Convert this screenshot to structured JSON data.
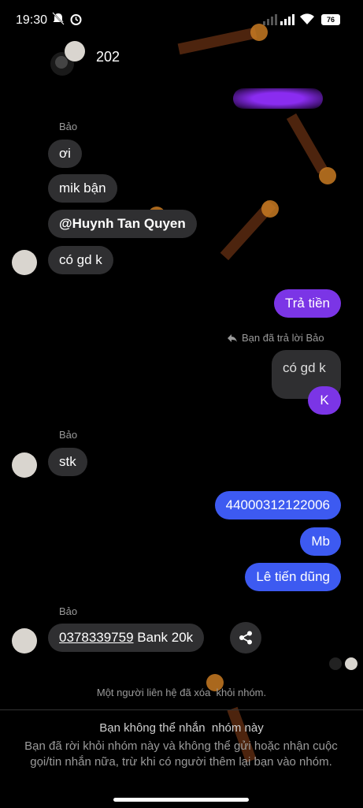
{
  "status": {
    "time": "19:30",
    "battery": "76"
  },
  "header": {
    "title": "202"
  },
  "messages": {
    "sender1": "Bảo",
    "m1": "ơi",
    "m2": "mik bận",
    "m3": "@Huynh Tan Quyen",
    "m4": "có gd k",
    "out1": "Trả tiền",
    "reply_note": "Bạn đã trả lời Bảo",
    "quoted": "có gd k",
    "reply": "K",
    "sender2": "Bảo",
    "m5": "stk",
    "out2": "44000312122006",
    "out3": "Mb",
    "out4": "Lê tiến dũng",
    "sender3": "Bảo",
    "m6_link": "0378339759",
    "m6_rest": " Bank 20k",
    "system_note": "Một người liên hệ đã xóa  khỏi nhóm."
  },
  "footer": {
    "title": "Bạn không thể nhắn  nhóm này",
    "body": "Bạn đã rời khỏi nhóm này và không thể gửi hoặc nhận cuộc gọi/tin nhắn nữa, trừ khi có người thêm lại bạn vào nhóm."
  },
  "icons": [
    "bell-off-icon",
    "alarm-icon",
    "signal-icon",
    "wifi-icon",
    "battery-icon",
    "reply-icon",
    "share-icon"
  ]
}
